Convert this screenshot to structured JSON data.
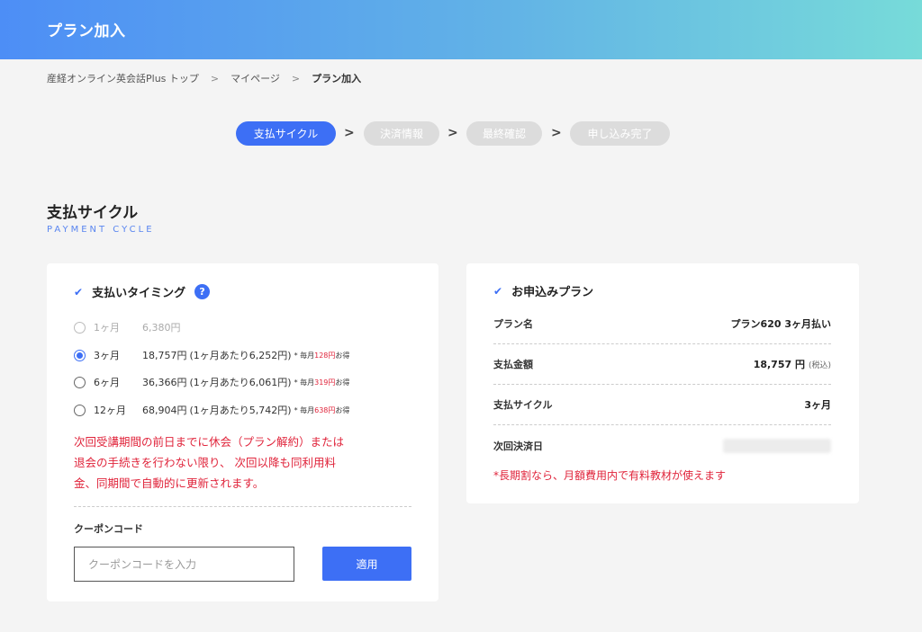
{
  "header": {
    "title": "プラン加入"
  },
  "breadcrumb": {
    "items": [
      "産経オンライン英会話Plus トップ",
      "マイページ",
      "プラン加入"
    ],
    "separator": ">"
  },
  "steps": [
    {
      "label": "支払サイクル",
      "active": true
    },
    {
      "label": "決済情報",
      "active": false
    },
    {
      "label": "最終確認",
      "active": false
    },
    {
      "label": "申し込み完了",
      "active": false
    }
  ],
  "step_arrow": ">",
  "section": {
    "title": "支払サイクル",
    "subtitle": "PAYMENT CYCLE"
  },
  "payment": {
    "heading": "支払いタイミング",
    "help_icon": "?",
    "options": [
      {
        "months": "1ヶ月",
        "price": "6,380円",
        "per_month": "",
        "note_prefix": "",
        "note_amount": "",
        "note_suffix": "",
        "selected": false,
        "disabled": true
      },
      {
        "months": "3ヶ月",
        "price": "18,757円",
        "per_month": "(1ヶ月あたり6,252円)",
        "note_prefix": "* 毎月",
        "note_amount": "128円",
        "note_suffix": "お得",
        "selected": true,
        "disabled": false
      },
      {
        "months": "6ヶ月",
        "price": "36,366円",
        "per_month": "(1ヶ月あたり6,061円)",
        "note_prefix": "* 毎月",
        "note_amount": "319円",
        "note_suffix": "お得",
        "selected": false,
        "disabled": false
      },
      {
        "months": "12ヶ月",
        "price": "68,904円",
        "per_month": "(1ヶ月あたり5,742円)",
        "note_prefix": "* 毎月",
        "note_amount": "638円",
        "note_suffix": "お得",
        "selected": false,
        "disabled": false
      }
    ],
    "notice_lines": [
      "次回受講期間の前日までに休会（プラン解約）または",
      "退会の手続きを行わない限り、 次回以降も同利用料",
      "金、同期間で自動的に更新されます。"
    ]
  },
  "coupon": {
    "label": "クーポンコード",
    "placeholder": "クーポンコードを入力",
    "value": "",
    "apply_label": "適用"
  },
  "plan": {
    "heading": "お申込みプラン",
    "rows": [
      {
        "label": "プラン名",
        "value": "プラン620 3ヶ月払い",
        "suffix": ""
      },
      {
        "label": "支払金額",
        "value": "18,757 円",
        "suffix": "(税込)"
      },
      {
        "label": "支払サイクル",
        "value": "3ヶ月",
        "suffix": ""
      },
      {
        "label": "次回決済日",
        "value": "",
        "suffix": ""
      }
    ],
    "note": "*長期割なら、月額費用内で有料教材が使えます"
  },
  "colors": {
    "accent": "#3d6ff5",
    "warning": "#e0243b",
    "step_inactive": "#dcdcdc"
  }
}
